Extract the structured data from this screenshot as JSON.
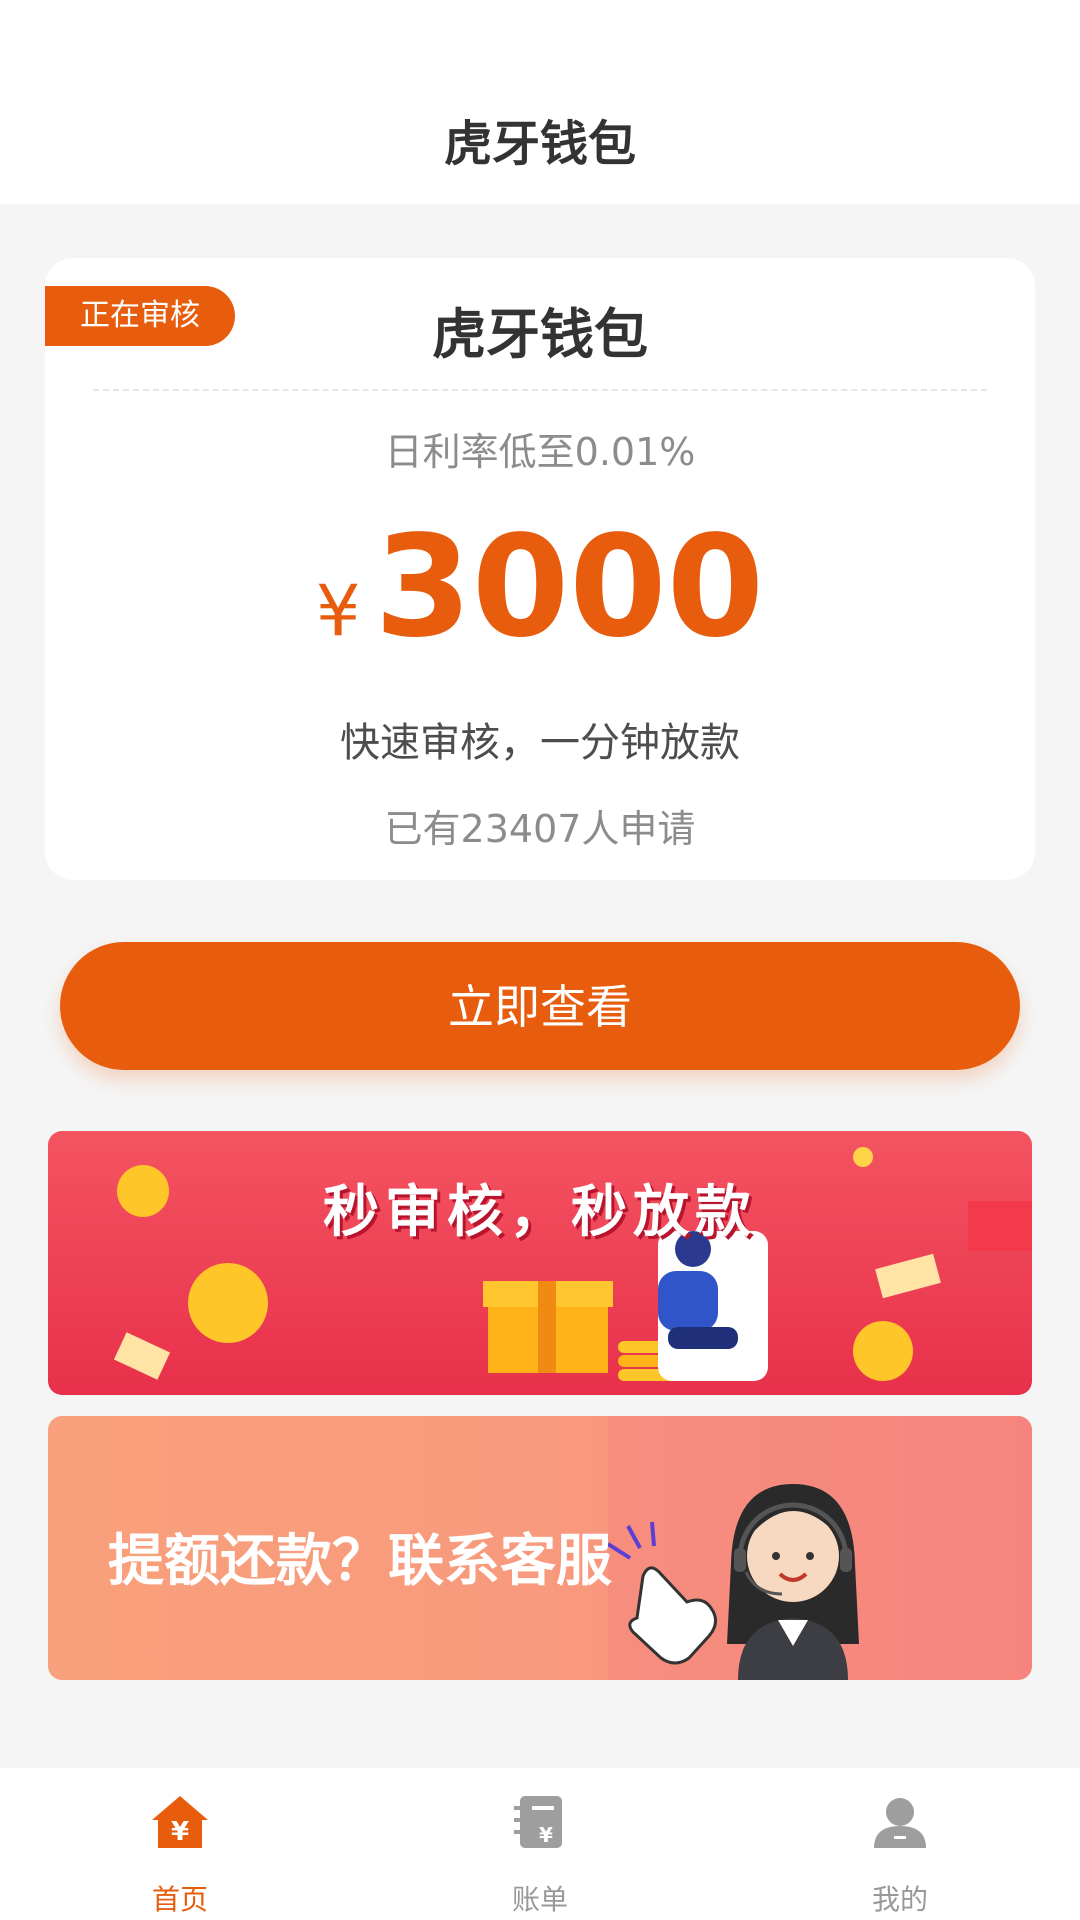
{
  "header": {
    "title": "虎牙钱包"
  },
  "card": {
    "badge": "正在审核",
    "name": "虎牙钱包",
    "rate_text": "日利率低至0.01%",
    "currency_symbol": "¥",
    "amount": "3000",
    "slogan": "快速审核，一分钟放款",
    "applicants_text": "已有23407人申请"
  },
  "cta": {
    "label": "立即查看"
  },
  "banners": {
    "promo": {
      "title": "秒审核，秒放款"
    },
    "service": {
      "title": "提额还款？联系客服"
    }
  },
  "tabbar": {
    "items": [
      {
        "label": "首页",
        "icon": "home-yen-icon",
        "active": true
      },
      {
        "label": "账单",
        "icon": "bill-icon",
        "active": false
      },
      {
        "label": "我的",
        "icon": "user-icon",
        "active": false
      }
    ]
  },
  "colors": {
    "accent": "#e85c0d",
    "tab_inactive": "#999999",
    "promo_banner": "#ee3c52",
    "service_banner": "#f9a07c"
  }
}
